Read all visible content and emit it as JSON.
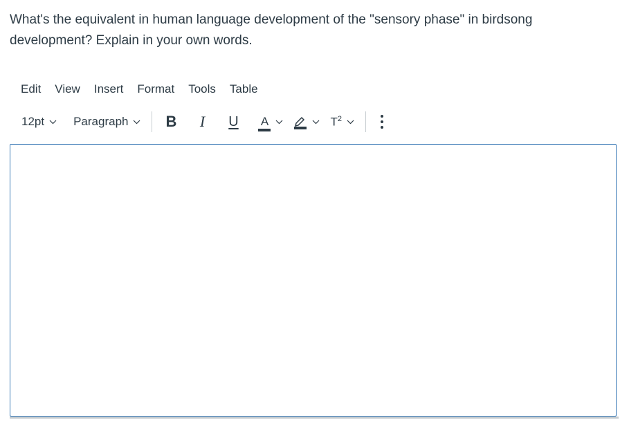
{
  "question": {
    "text": "What's the equivalent in human language development of the \"sensory phase\" in birdsong development? Explain in your own words."
  },
  "menubar": {
    "items": [
      {
        "label": "Edit"
      },
      {
        "label": "View"
      },
      {
        "label": "Insert"
      },
      {
        "label": "Format"
      },
      {
        "label": "Tools"
      },
      {
        "label": "Table"
      }
    ]
  },
  "toolbar": {
    "font_size": "12pt",
    "block_format": "Paragraph",
    "bold_label": "B",
    "italic_label": "I",
    "underline_label": "U",
    "text_color_label": "A",
    "superscript_label": "T",
    "superscript_mark": "2",
    "icons": {
      "font_size_chevron": "chevron-down-icon",
      "highlight": "highlighter-icon",
      "more": "more-vertical-icon"
    }
  },
  "editor": {
    "content": "",
    "border_color": "#3a79b6"
  }
}
